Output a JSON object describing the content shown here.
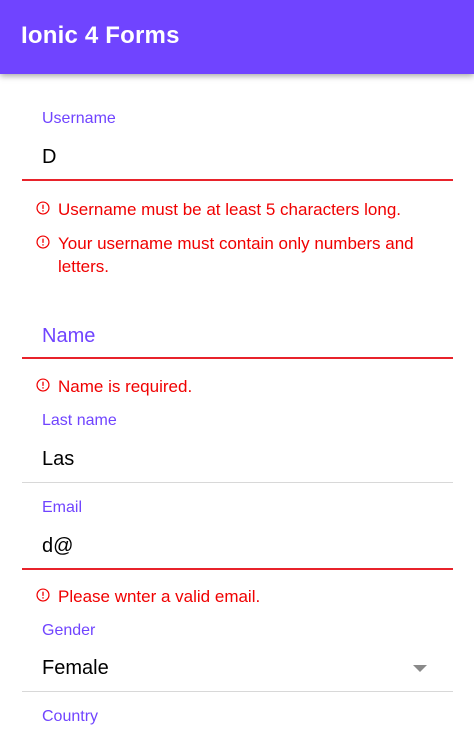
{
  "toolbar": {
    "title": "Ionic 4 Forms"
  },
  "form": {
    "username": {
      "label": "Username",
      "value": "D",
      "errors": [
        "Username must be at least 5 characters long.",
        "Your username must contain only numbers and letters."
      ]
    },
    "name": {
      "label": "Name",
      "value": "",
      "errors": [
        "Name is required."
      ]
    },
    "last_name": {
      "label": "Last name",
      "value": "Las"
    },
    "email": {
      "label": "Email",
      "value": "d@",
      "errors": [
        "Please wnter a valid email."
      ]
    },
    "gender": {
      "label": "Gender",
      "value": "Female"
    },
    "country": {
      "label": "Country"
    }
  },
  "colors": {
    "primary": "#7044ff",
    "error": "#f00000",
    "error_underline": "#e8232b"
  },
  "icons": {
    "error": "alert-circle-outline-icon",
    "select": "caret-down-icon"
  }
}
